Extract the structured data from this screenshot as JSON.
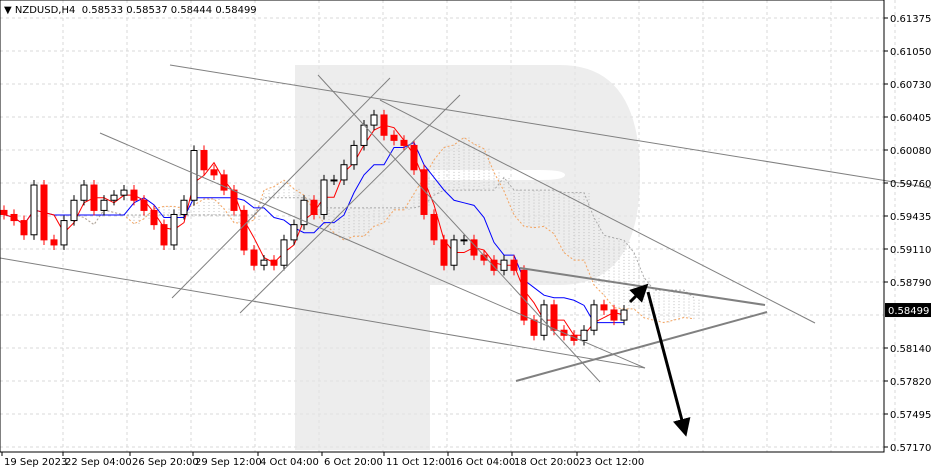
{
  "header": {
    "symbol": "NZDUSD,H4",
    "ohlc": "0.58533 0.58537 0.58444 0.58499"
  },
  "chart_data": {
    "type": "candlestick",
    "title": "NZDUSD,H4 0.58533 0.58537 0.58444 0.58499",
    "current_price": 0.58499,
    "current_price_label": "0.58499",
    "ylim": [
      0.5714,
      0.6152
    ],
    "y_ticks": [
      "0.61375",
      "0.61050",
      "0.60730",
      "0.60405",
      "0.60080",
      "0.59760",
      "0.59435",
      "0.59110",
      "0.58790",
      "0.58140",
      "0.57820",
      "0.57495",
      "0.57170"
    ],
    "x_ticks": [
      "19 Sep 2023",
      "22 Sep 04:00",
      "26 Sep 20:00",
      "29 Sep 12:00",
      "4 Oct 04:00",
      "6 Oct 20:00",
      "11 Oct 12:00",
      "16 Oct 04:00",
      "18 Oct 20:00",
      "23 Oct 12:00"
    ],
    "closes": [
      0.5944,
      0.5938,
      0.5924,
      0.5973,
      0.5919,
      0.5914,
      0.5938,
      0.5958,
      0.5973,
      0.5948,
      0.5958,
      0.5963,
      0.5968,
      0.5958,
      0.5948,
      0.5934,
      0.5914,
      0.5944,
      0.5958,
      0.6007,
      0.5988,
      0.5983,
      0.5968,
      0.5948,
      0.5909,
      0.5894,
      0.5899,
      0.5894,
      0.5919,
      0.5934,
      0.5958,
      0.5944,
      0.5978,
      0.5978,
      0.5993,
      0.6012,
      0.6032,
      0.6042,
      0.6022,
      0.6017,
      0.6012,
      0.5988,
      0.5944,
      0.5919,
      0.5894,
      0.5919,
      0.5919,
      0.5904,
      0.5899,
      0.5889,
      0.5899,
      0.5889,
      0.584,
      0.5825,
      0.5855,
      0.583,
      0.5825,
      0.582,
      0.583,
      0.5855,
      0.585,
      0.584,
      0.58499
    ],
    "indicators": [
      "Ichimoku Tenkan-sen (red)",
      "Ichimoku Kijun-sen (blue)",
      "Ichimoku cloud (dotted)"
    ],
    "forecast": "short rebound to ~0.5877 then decline toward ~0.5720",
    "colors": {
      "up": "#000000",
      "down": "#ff0000",
      "tenkan": "#ff0000",
      "kijun": "#0000ff",
      "cloud_a": "#f4a460",
      "cloud_b": "#a9a9a9",
      "trend": "#808080"
    }
  }
}
